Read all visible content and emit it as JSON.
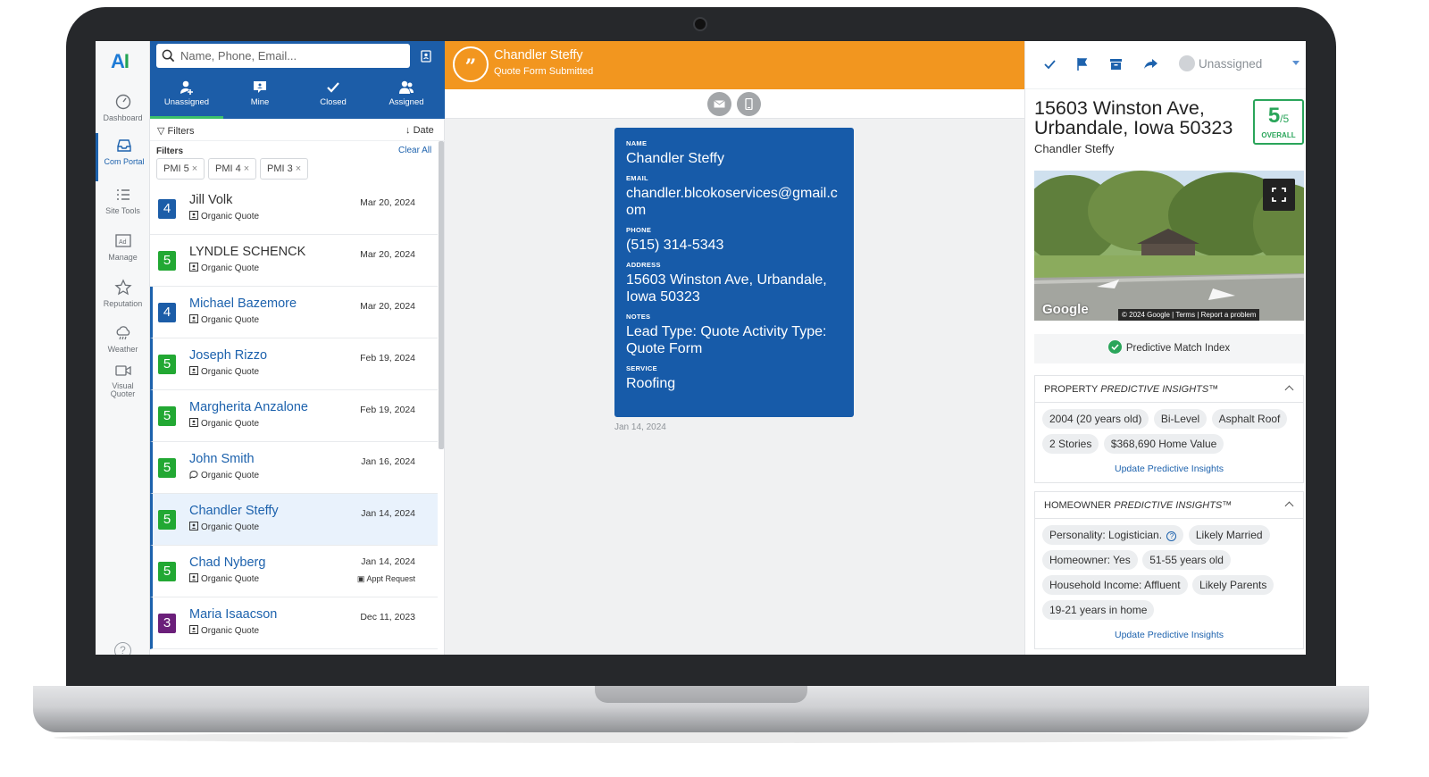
{
  "nav": {
    "items": [
      {
        "label": "Dashboard",
        "icon": "speedometer-icon"
      },
      {
        "label": "Com Portal",
        "icon": "inbox-icon"
      },
      {
        "label": "Site Tools",
        "icon": "list-icon"
      },
      {
        "label": "Manage",
        "icon": "ad-icon"
      },
      {
        "label": "Reputation",
        "icon": "star-icon"
      },
      {
        "label": "Weather",
        "icon": "cloud-rain-icon"
      },
      {
        "label": "Visual Quoter",
        "icon": "video-icon"
      }
    ]
  },
  "list": {
    "search_placeholder": "Name, Phone, Email...",
    "tabs": [
      {
        "label": "Unassigned"
      },
      {
        "label": "Mine"
      },
      {
        "label": "Closed"
      },
      {
        "label": "Assigned"
      }
    ],
    "filters_button": "Filters",
    "date_button": "Date",
    "filters_label": "Filters",
    "clear_all": "Clear All",
    "chips": [
      "PMI 5",
      "PMI 4",
      "PMI 3"
    ],
    "leads": [
      {
        "score": "4",
        "name": "Jill Volk",
        "source": "Organic Quote",
        "date": "Mar 20, 2024",
        "appt": ""
      },
      {
        "score": "5",
        "name": "LYNDLE SCHENCK",
        "source": "Organic Quote",
        "date": "Mar 20, 2024",
        "appt": ""
      },
      {
        "score": "4",
        "name": "Michael Bazemore",
        "source": "Organic Quote",
        "date": "Mar 20, 2024",
        "appt": ""
      },
      {
        "score": "5",
        "name": "Joseph Rizzo",
        "source": "Organic Quote",
        "date": "Feb 19, 2024",
        "appt": ""
      },
      {
        "score": "5",
        "name": "Margherita Anzalone",
        "source": "Organic Quote",
        "date": "Feb 19, 2024",
        "appt": ""
      },
      {
        "score": "5",
        "name": "John Smith",
        "source": "Organic Quote",
        "date": "Jan 16, 2024",
        "appt": ""
      },
      {
        "score": "5",
        "name": "Chandler Steffy",
        "source": "Organic Quote",
        "date": "Jan 14, 2024",
        "appt": ""
      },
      {
        "score": "5",
        "name": "Chad Nyberg",
        "source": "Organic Quote",
        "date": "Jan 14, 2024",
        "appt": "Appt Request"
      },
      {
        "score": "3",
        "name": "Maria Isaacson",
        "source": "Organic Quote",
        "date": "Dec 11, 2023",
        "appt": ""
      }
    ]
  },
  "conversation": {
    "title": "Chandler Steffy",
    "subtitle": "Quote Form Submitted",
    "card": {
      "name_label": "NAME",
      "name": "Chandler Steffy",
      "email_label": "EMAIL",
      "email": "chandler.blcokoservices@gmail.com",
      "phone_label": "PHONE",
      "phone": "(515) 314-5343",
      "address_label": "ADDRESS",
      "address": "15603 Winston Ave, Urbandale, Iowa 50323",
      "notes_label": "NOTES",
      "notes": "Lead Type: Quote Activity Type: Quote Form",
      "service_label": "SERVICE",
      "service": "Roofing"
    },
    "date": "Jan 14, 2024"
  },
  "detail": {
    "assignee": "Unassigned",
    "address": "15603 Winston Ave, Urbandale, Iowa 50323",
    "owner": "Chandler Steffy",
    "score_value": "5",
    "score_max": "/5",
    "score_label": "OVERALL",
    "map_attribution": "© 2024 Google  |  Terms  |  Report a problem",
    "map_logo": "Google",
    "pmi_label": "Predictive Match Index",
    "property": {
      "title_prefix": "PROPERTY",
      "title_italic": "PREDICTIVE INSIGHTS™",
      "pills": [
        "2004 (20 years old)",
        "Bi-Level",
        "Asphalt Roof",
        "2 Stories",
        "$368,690 Home Value"
      ],
      "update_link": "Update Predictive Insights"
    },
    "homeowner": {
      "title_prefix": "HOMEOWNER",
      "title_italic": "PREDICTIVE INSIGHTS™",
      "pills": [
        "Personality: Logistician.",
        "Likely Married",
        "Homeowner: Yes",
        "51-55 years old",
        "Household Income: Affluent",
        "Likely Parents",
        "19-21 years in home"
      ],
      "update_link": "Update Predictive Insights"
    }
  },
  "colors": {
    "primary": "#1c5da8",
    "orange": "#f2961f",
    "green": "#2aa55a",
    "score5": "#22a833",
    "score4": "#1c5da8",
    "score3": "#6b1f7a"
  }
}
